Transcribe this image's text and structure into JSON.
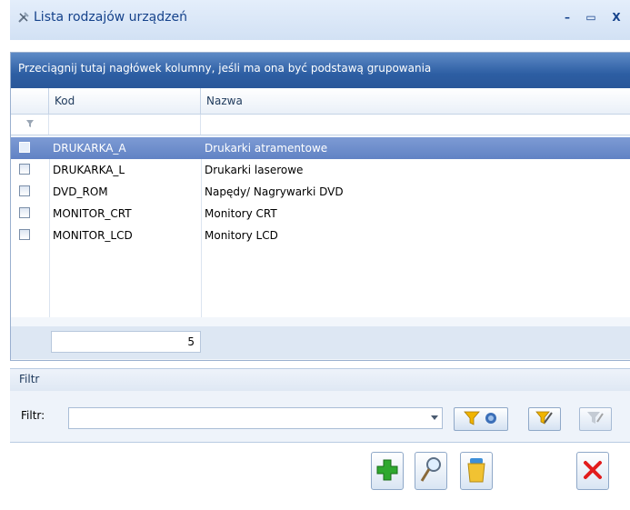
{
  "window": {
    "title": "Lista rodzajów urządzeń",
    "minimize_glyph": "–",
    "maximize_glyph": "▭",
    "close_glyph": "X"
  },
  "grid": {
    "group_hint": "Przeciągnij tutaj nagłówek kolumny, jeśli ma ona być podstawą grupowania",
    "columns": [
      "Kod",
      "Nazwa"
    ],
    "rows": [
      {
        "kod": "DRUKARKA_A",
        "nazwa": "Drukarki atramentowe",
        "selected": true
      },
      {
        "kod": "DRUKARKA_L",
        "nazwa": "Drukarki laserowe",
        "selected": false
      },
      {
        "kod": "DVD_ROM",
        "nazwa": "Napędy/ Nagrywarki DVD",
        "selected": false
      },
      {
        "kod": "MONITOR_CRT",
        "nazwa": "Monitory CRT",
        "selected": false
      },
      {
        "kod": "MONITOR_LCD",
        "nazwa": "Monitory LCD",
        "selected": false
      }
    ],
    "row_count": "5"
  },
  "filter": {
    "section_title": "Filtr",
    "label": "Filtr:",
    "value": ""
  },
  "icons": {
    "app": "tools-icon",
    "filter_row": "funnel-icon",
    "add": "plus-icon",
    "edit": "magnifier-icon",
    "delete": "trash-icon",
    "close": "cross-icon"
  },
  "colors": {
    "group_panel": "#2d5ea3",
    "selected_row": "#6b8bcb",
    "add_green": "#2fa82f",
    "close_red": "#e21c1c",
    "filter_yellow": "#f0b400"
  }
}
